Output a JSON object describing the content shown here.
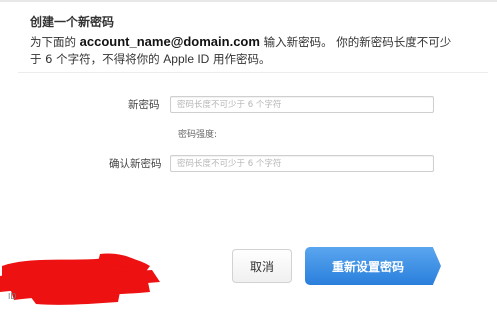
{
  "dialog": {
    "heading": "创建一个新密码",
    "intro": {
      "prefix": "为下面的",
      "account": "account_name@domain.com",
      "suffix": "输入新密码。 你的新密码长度不可少",
      "line2_a": "于 6 个字符，不得将你的",
      "apple_id": "Apple ID",
      "line2_b": "用作密码。"
    }
  },
  "form": {
    "new_password": {
      "label": "新密码",
      "placeholder": "密码长度不可少于 6 个字符"
    },
    "strength_label": "密码强度:",
    "confirm_password": {
      "label": "确认新密码",
      "placeholder": "密码长度不可少于 6 个字符"
    }
  },
  "buttons": {
    "cancel": "取消",
    "reset": "重新设置密码"
  },
  "redaction": {
    "color": "#ee1111",
    "partial_text": "ID"
  }
}
